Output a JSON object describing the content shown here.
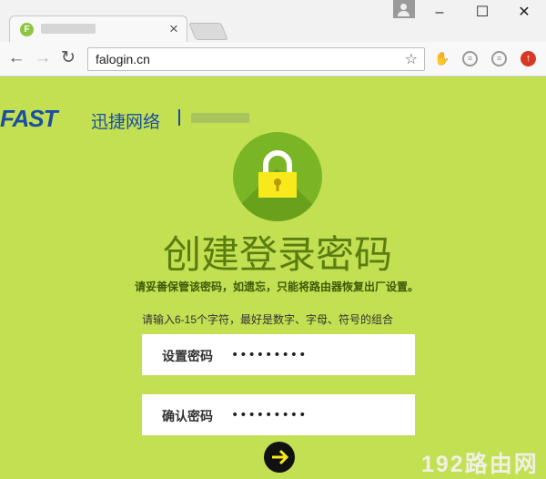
{
  "browser": {
    "tab": {
      "favicon_letter": "F",
      "close_label": "×"
    },
    "window_controls": {
      "minimize": "–",
      "maximize": "☐",
      "close": "✕"
    },
    "nav": {
      "back": "←",
      "forward": "→",
      "reload": "↻"
    },
    "address": {
      "url": "falogin.cn",
      "star": "☆"
    },
    "extensions": [
      {
        "name": "hand-extension-icon",
        "glyph": "✋"
      },
      {
        "name": "grey-extension-icon",
        "glyph": "≡"
      },
      {
        "name": "grey-extension-icon-2",
        "glyph": "≡"
      },
      {
        "name": "update-icon",
        "glyph": "↑"
      }
    ]
  },
  "brand": {
    "logo_text": "FAST",
    "cn_name": "迅捷网络",
    "primary_color": "#1a4ea1"
  },
  "page": {
    "background_color": "#c3df52",
    "heading": "创建登录密码",
    "subtitle": "请妥善保管该密码，如遗忘，只能将路由器恢复出厂设置。",
    "hint": "请输入6-15个字符，最好是数字、字母、符号的组合",
    "password_field": {
      "label": "设置密码",
      "value": "•••••••••"
    },
    "confirm_field": {
      "label": "确认密码",
      "value": "•••••••••"
    },
    "submit_icon": "arrow-right-icon"
  },
  "watermark": "192路由网"
}
